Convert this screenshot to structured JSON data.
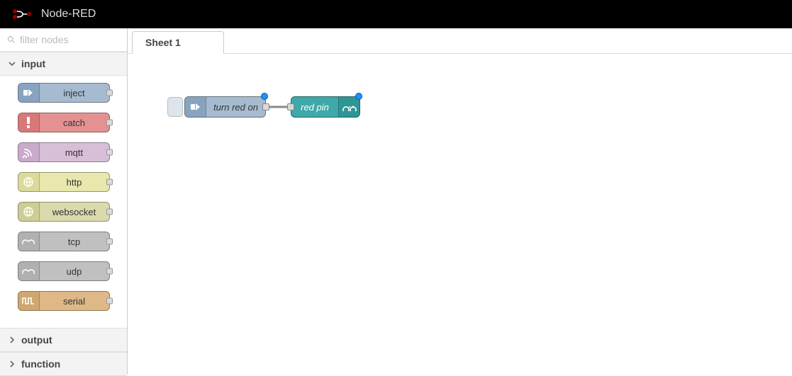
{
  "app": {
    "title": "Node-RED"
  },
  "sidebar": {
    "filter_placeholder": "filter nodes",
    "categories": [
      {
        "name": "input",
        "expanded": true,
        "nodes": [
          {
            "label": "inject",
            "kind": "inject"
          },
          {
            "label": "catch",
            "kind": "catch"
          },
          {
            "label": "mqtt",
            "kind": "mqtt"
          },
          {
            "label": "http",
            "kind": "http"
          },
          {
            "label": "websocket",
            "kind": "websocket"
          },
          {
            "label": "tcp",
            "kind": "tcp"
          },
          {
            "label": "udp",
            "kind": "udp"
          },
          {
            "label": "serial",
            "kind": "serial"
          }
        ]
      },
      {
        "name": "output",
        "expanded": false
      },
      {
        "name": "function",
        "expanded": false
      }
    ]
  },
  "workspace": {
    "tabs": [
      {
        "label": "Sheet 1",
        "active": true
      }
    ],
    "nodes": {
      "inject": {
        "label": "turn red on"
      },
      "arduino": {
        "label": "red pin"
      }
    }
  }
}
